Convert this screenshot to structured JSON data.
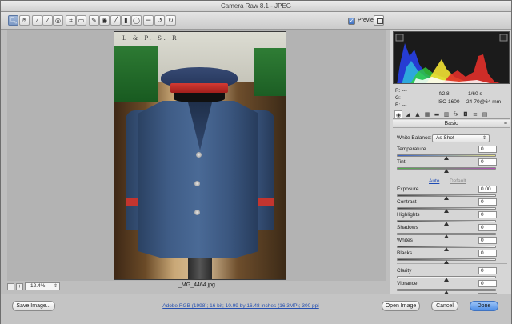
{
  "window": {
    "title": "Camera Raw 8.1  -  JPEG"
  },
  "toolbar": {
    "tools": [
      {
        "name": "zoom-tool-icon",
        "glyph": "🔍︎",
        "active": true
      },
      {
        "name": "hand-tool-icon",
        "glyph": "✋︎"
      },
      {
        "name": "white-balance-tool-icon",
        "glyph": "⁄"
      },
      {
        "name": "color-sampler-tool-icon",
        "glyph": "⁄"
      },
      {
        "name": "targeted-adjustment-tool-icon",
        "glyph": "◎"
      },
      {
        "name": "crop-tool-icon",
        "glyph": "⌗"
      },
      {
        "name": "straighten-tool-icon",
        "glyph": "▭"
      },
      {
        "name": "spot-removal-tool-icon",
        "glyph": "✎"
      },
      {
        "name": "red-eye-removal-tool-icon",
        "glyph": "◉"
      },
      {
        "name": "adjustment-brush-icon",
        "glyph": "╱"
      },
      {
        "name": "graduated-filter-icon",
        "glyph": "▮"
      },
      {
        "name": "radial-filter-icon",
        "glyph": "◯"
      },
      {
        "name": "preferences-icon",
        "glyph": "☰"
      },
      {
        "name": "rotate-ccw-icon",
        "glyph": "↺"
      },
      {
        "name": "rotate-cw-icon",
        "glyph": "↻"
      }
    ],
    "preview_label": "Preview",
    "preview_checked": "✓"
  },
  "canvas": {
    "zoom_out": "−",
    "zoom_in": "+",
    "zoom_value": "12.4%",
    "zoom_arrow": "⇕",
    "filename": "_MG_4464.jpg",
    "photo_wall_text": "L & P. S. R"
  },
  "histogram": {
    "colors": {
      "red": "#e2302a",
      "green": "#2fd03b",
      "blue": "#2840e8",
      "yellow": "#f2e233",
      "cyan": "#30d6e0",
      "white": "#ffffff"
    }
  },
  "readout": {
    "r_label": "R:",
    "r_value": "---",
    "g_label": "G:",
    "g_value": "---",
    "b_label": "B:",
    "b_value": "---",
    "aperture": "f/2.8",
    "shutter": "1/60 s",
    "iso": "ISO 1600",
    "lens": "24-70@64 mm"
  },
  "panel": {
    "tabs": [
      {
        "name": "tab-basic-icon",
        "glyph": "◉",
        "active": true
      },
      {
        "name": "tab-tone-curve-icon",
        "glyph": "◢"
      },
      {
        "name": "tab-detail-icon",
        "glyph": "▲"
      },
      {
        "name": "tab-hsl-icon",
        "glyph": "▦"
      },
      {
        "name": "tab-split-toning-icon",
        "glyph": "▬"
      },
      {
        "name": "tab-lens-corrections-icon",
        "glyph": "▥"
      },
      {
        "name": "tab-effects-icon",
        "glyph": "fx"
      },
      {
        "name": "tab-camera-calibration-icon",
        "glyph": "◘"
      },
      {
        "name": "tab-presets-icon",
        "glyph": "≡"
      },
      {
        "name": "tab-snapshots-icon",
        "glyph": "▤"
      }
    ],
    "section_title": "Basic",
    "section_menu": "≡",
    "white_balance_label": "White Balance:",
    "white_balance_value": "As Shot",
    "white_balance_arrow": "⇕",
    "auto_label": "Auto",
    "default_label": "Default",
    "sliders": [
      {
        "key": "temperature",
        "label": "Temperature",
        "value": "0",
        "position": 0.5,
        "track": "temp"
      },
      {
        "key": "tint",
        "label": "Tint",
        "value": "0",
        "position": 0.5,
        "track": "tint"
      },
      {
        "key": "exposure",
        "label": "Exposure",
        "value": "0.00",
        "position": 0.5,
        "track": "grey"
      },
      {
        "key": "contrast",
        "label": "Contrast",
        "value": "0",
        "position": 0.5,
        "track": "grey"
      },
      {
        "key": "highlights",
        "label": "Highlights",
        "value": "0",
        "position": 0.5,
        "track": "grey"
      },
      {
        "key": "shadows",
        "label": "Shadows",
        "value": "0",
        "position": 0.5,
        "track": "grey"
      },
      {
        "key": "whites",
        "label": "Whites",
        "value": "0",
        "position": 0.5,
        "track": "grey"
      },
      {
        "key": "blacks",
        "label": "Blacks",
        "value": "0",
        "position": 0.5,
        "track": "grey"
      },
      {
        "key": "clarity",
        "label": "Clarity",
        "value": "0",
        "position": 0.5,
        "track": "flat"
      },
      {
        "key": "vibrance",
        "label": "Vibrance",
        "value": "0",
        "position": 0.5,
        "track": "sat"
      },
      {
        "key": "saturation",
        "label": "Saturation",
        "value": "0",
        "position": 0.5,
        "track": "sat"
      }
    ]
  },
  "footer": {
    "save_label": "Save Image...",
    "workflow_link": "Adobe RGB (1998); 16 bit; 10.99 by 16.48 inches (16.3MP); 300 ppi",
    "open_label": "Open Image",
    "cancel_label": "Cancel",
    "done_label": "Done"
  }
}
